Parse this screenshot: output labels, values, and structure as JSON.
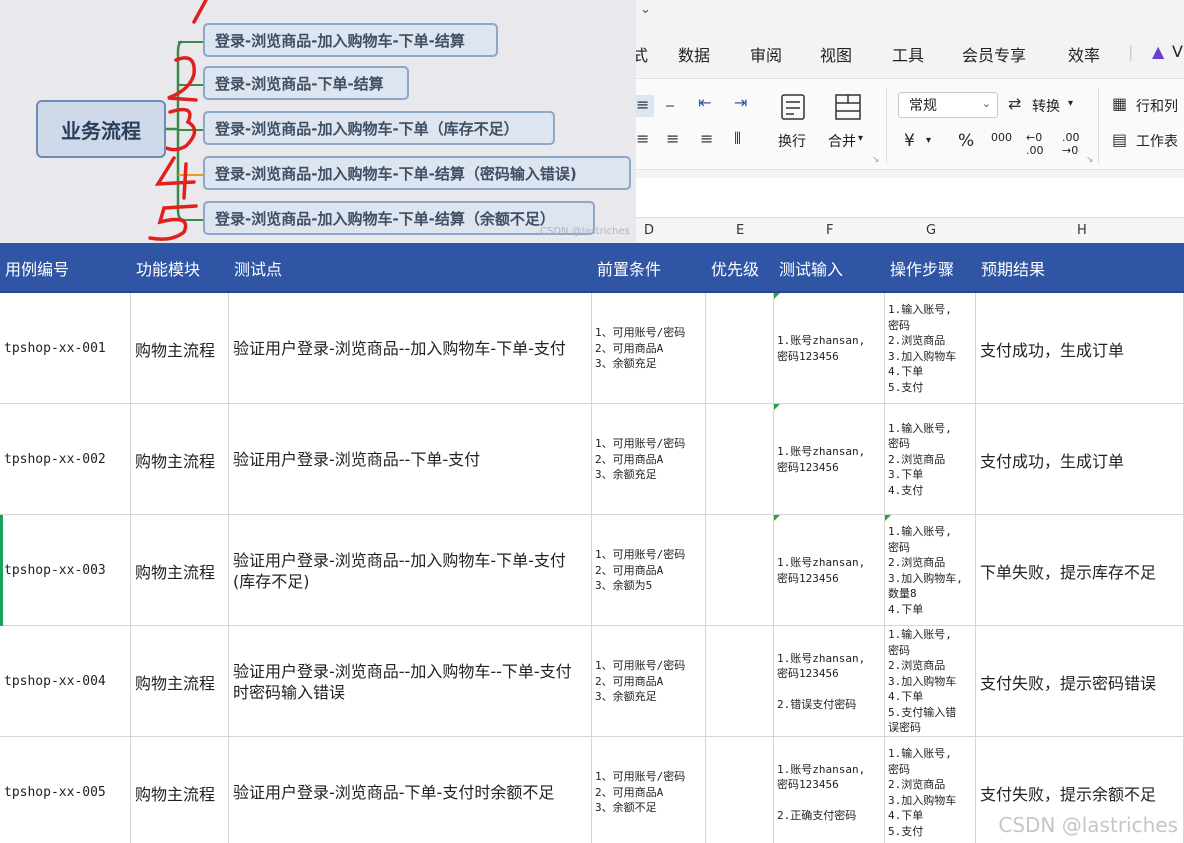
{
  "mindmap": {
    "root": "业务流程",
    "branches": [
      "登录-浏览商品-加入购物车-下单-结算",
      "登录-浏览商品-下单-结算",
      "登录-浏览商品-加入购物车-下单（库存不足）",
      "登录-浏览商品-加入购物车-下单-结算（密码输入错误)",
      "登录-浏览商品-加入购物车-下单-结算（余额不足）"
    ],
    "handwritten_numbers": [
      "1",
      "2",
      "3",
      "4",
      "5"
    ],
    "watermark": "CSDN @lastriches"
  },
  "ribbon": {
    "tabs": [
      "式",
      "数据",
      "审阅",
      "视图",
      "工具",
      "会员专享",
      "效率",
      "V"
    ],
    "wrap_label": "换行",
    "merge_label": "合并",
    "number_format": "常规",
    "convert_label": "转换",
    "currency_symbol": "¥",
    "percent_symbol": "%",
    "thousands_symbol": "000",
    "rows_cols_label": "行和列",
    "worksheet_label": "工作表",
    "column_letters": [
      "D",
      "E",
      "F",
      "G",
      "H"
    ]
  },
  "table": {
    "headers": [
      "用例编号",
      "功能模块",
      "测试点",
      "前置条件",
      "优先级",
      "测试输入",
      "操作步骤",
      "预期结果"
    ],
    "rows": [
      {
        "id": "tpshop-xx-001",
        "module": "购物主流程",
        "point": "验证用户登录-浏览商品--加入购物车-下单-支付",
        "precondition": "1、可用账号/密码\n2、可用商品A\n3、余额充足",
        "priority": "",
        "input": "1.账号zhansan,\n密码123456",
        "steps": "1.输入账号,\n密码\n2.浏览商品\n3.加入购物车\n4.下单\n5.支付",
        "result": "支付成功，生成订单"
      },
      {
        "id": "tpshop-xx-002",
        "module": "购物主流程",
        "point": "验证用户登录-浏览商品--下单-支付",
        "precondition": "1、可用账号/密码\n2、可用商品A\n3、余额充足",
        "priority": "",
        "input": "1.账号zhansan,\n密码123456",
        "steps": "1.输入账号,\n密码\n2.浏览商品\n3.下单\n4.支付",
        "result": "支付成功，生成订单"
      },
      {
        "id": "tpshop-xx-003",
        "module": "购物主流程",
        "point": "验证用户登录-浏览商品--加入购物车-下单-支付\n(库存不足)",
        "precondition": "1、可用账号/密码\n2、可用商品A\n3、余额为5",
        "priority": "",
        "input": "1.账号zhansan,\n密码123456",
        "steps": "1.输入账号,\n密码\n2.浏览商品\n3.加入购物车,\n数量8\n4.下单",
        "result": "下单失败，提示库存不足"
      },
      {
        "id": "tpshop-xx-004",
        "module": "购物主流程",
        "point": "验证用户登录-浏览商品--加入购物车--下单-支付\n时密码输入错误",
        "precondition": "1、可用账号/密码\n2、可用商品A\n3、余额充足",
        "priority": "",
        "input": "1.账号zhansan,\n密码123456\n\n2.错误支付密码",
        "steps": "1.输入账号,\n密码\n2.浏览商品\n3.加入购物车\n4.下单\n5.支付输入错\n误密码",
        "result": "支付失败，提示密码错误"
      },
      {
        "id": "tpshop-xx-005",
        "module": "购物主流程",
        "point": "验证用户登录-浏览商品-下单-支付时余额不足",
        "precondition": "1、可用账号/密码\n2、可用商品A\n3、余额不足",
        "priority": "",
        "input": "1.账号zhansan,\n密码123456\n\n2.正确支付密码",
        "steps": "1.输入账号,\n密码\n2.浏览商品\n3.加入购物车\n4.下单\n5.支付",
        "result": "支付失败，提示余额不足"
      }
    ]
  },
  "watermark": "CSDN @lastriches",
  "colors": {
    "header_bg": "#2f55a4",
    "header_text": "#ffffff",
    "mindmap_bg": "#e9e8ec",
    "bracket_green": "#3a8a4a",
    "handwriting_red": "#e0201c",
    "active_row_marker": "#19a35a"
  }
}
